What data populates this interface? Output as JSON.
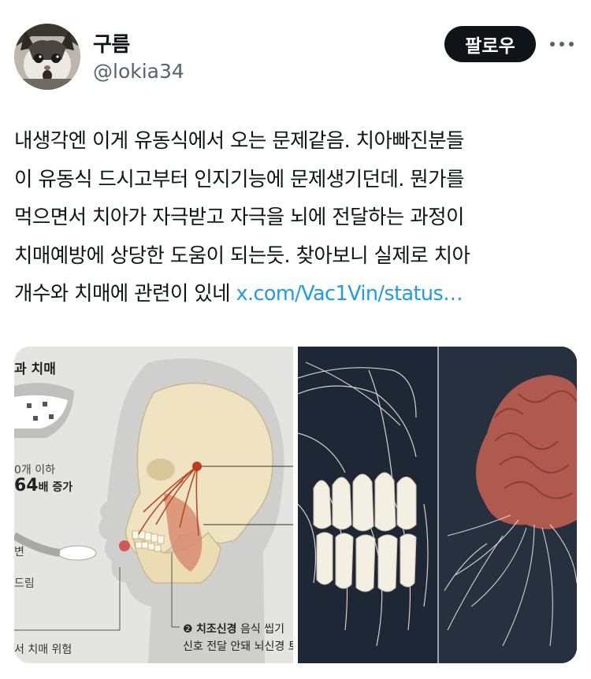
{
  "author": {
    "display_name": "구름",
    "handle": "@lokia34"
  },
  "follow_button": "팔로우",
  "tweet": {
    "lines": [
      "내생각엔 이게 유동식에서 오는 문제같음. 치아빠진분들",
      "이 유동식 드시고부터 인지기능에 문제생기던데. 뭔가를",
      "먹으면서 치아가 자극받고 자극을 뇌에 전달하는 과정이",
      "치매예방에 상당한 도움이 되는듯. 찾아보니 실제로 치아",
      "개수와 치매에 관련이 있네 "
    ],
    "link": "x.com/Vac1Vin/status…"
  },
  "media": {
    "left_labels": {
      "title": "과 치매",
      "teeth_count": "0개 이하",
      "ratio": "64",
      "ratio_suffix": "배 증가",
      "side1": "변",
      "side2": "드림",
      "bottom_left": "서 치매 위험",
      "nerve_number": "❷",
      "nerve_title": "치조신경",
      "nerve_desc1": "음식 씹기 ",
      "nerve_desc2": "신호 전달 안돼 뇌신경 ",
      "nerve_desc2_end": "토"
    }
  },
  "colors": {
    "accent_link": "#1d9bf0",
    "button_bg": "#0f1419",
    "secondary_text": "#536471"
  }
}
